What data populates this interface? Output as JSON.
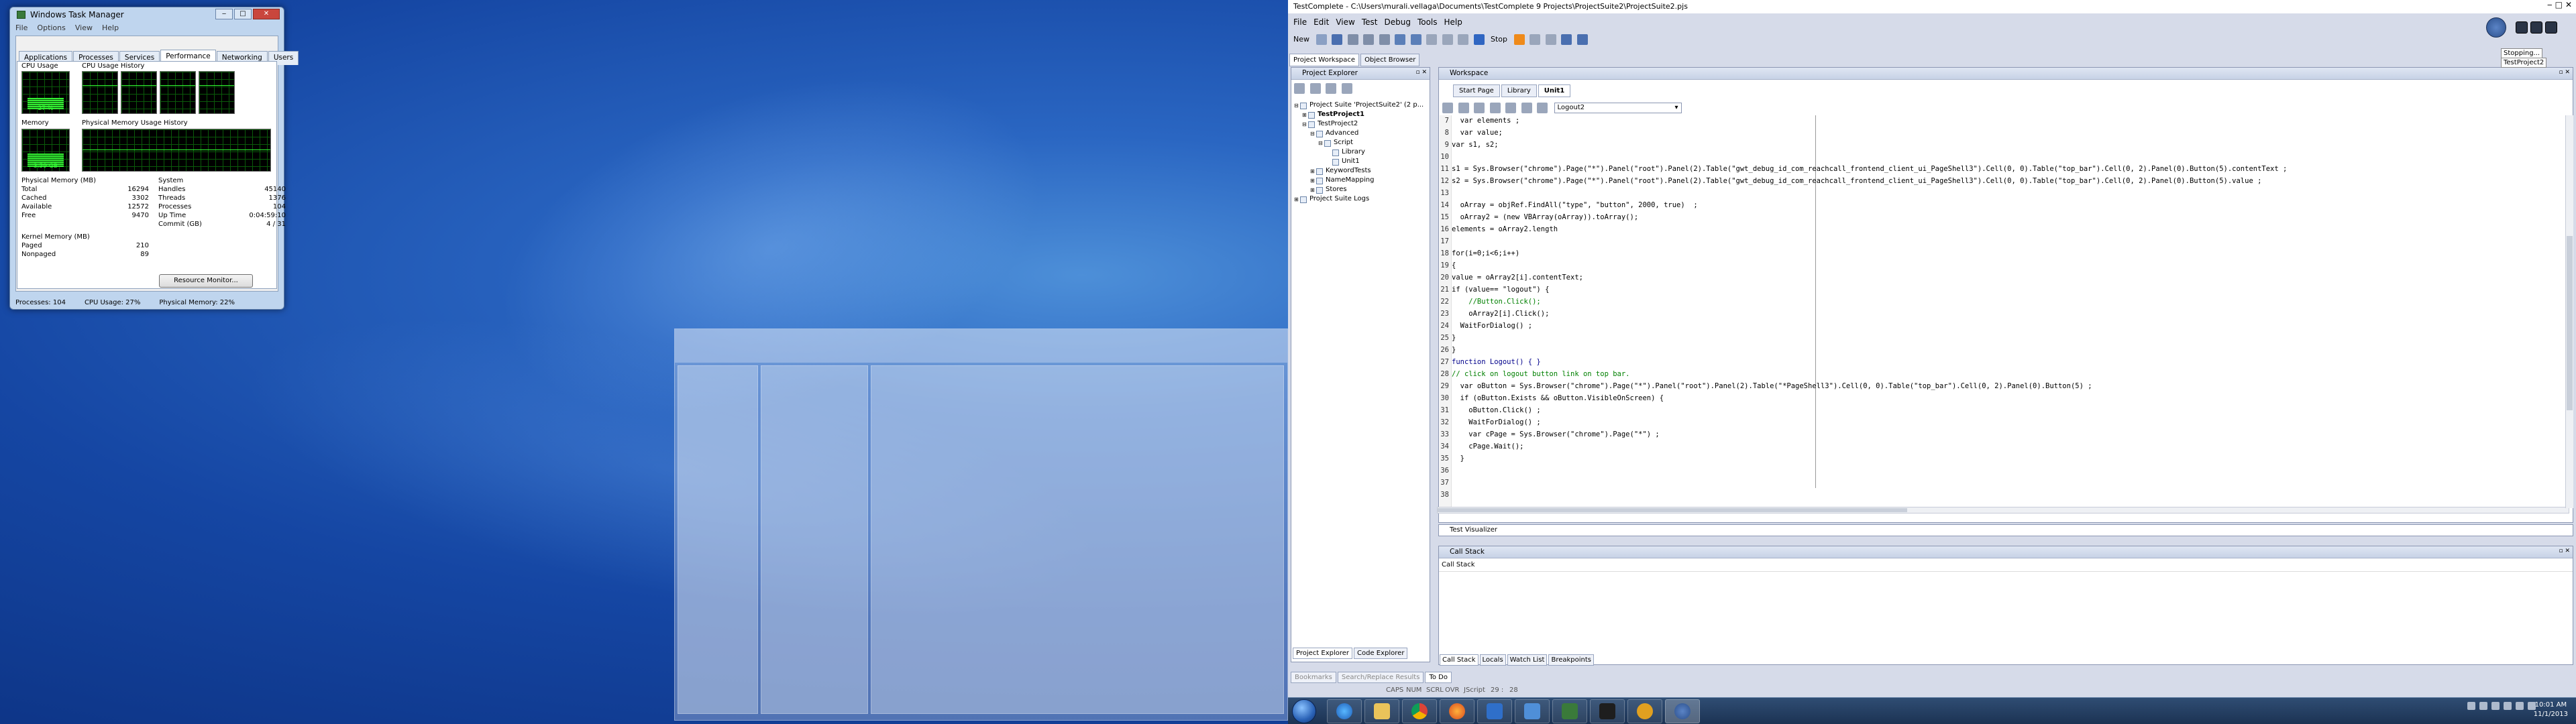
{
  "taskmanager": {
    "title": "Windows Task Manager",
    "menu": [
      "File",
      "Options",
      "View",
      "Help"
    ],
    "tabs": [
      "Applications",
      "Processes",
      "Services",
      "Performance",
      "Networking",
      "Users"
    ],
    "cpu_usage_label": "CPU Usage",
    "cpu_history_label": "CPU Usage History",
    "cpu_usage_value": "27 %",
    "cpu_fraction": 0.27,
    "memory_label": "Memory",
    "memory_value": "3.59 GB",
    "memory_fraction": 0.22,
    "phys_history_label": "Physical Memory Usage History",
    "physical_memory": {
      "title": "Physical Memory (MB)",
      "rows": [
        [
          "Total",
          "16294"
        ],
        [
          "Cached",
          "3302"
        ],
        [
          "Available",
          "12572"
        ],
        [
          "Free",
          "9470"
        ]
      ]
    },
    "system": {
      "title": "System",
      "rows": [
        [
          "Handles",
          "45140"
        ],
        [
          "Threads",
          "1376"
        ],
        [
          "Processes",
          "104"
        ],
        [
          "Up Time",
          "0:04:59:10"
        ],
        [
          "Commit (GB)",
          "4 / 31"
        ]
      ]
    },
    "kernel_memory": {
      "title": "Kernel Memory (MB)",
      "rows": [
        [
          "Paged",
          "210"
        ],
        [
          "Nonpaged",
          "89"
        ]
      ]
    },
    "resource_monitor_button": "Resource Monitor...",
    "status": {
      "processes": "Processes: 104",
      "cpu": "CPU Usage: 27%",
      "memory": "Physical Memory: 22%"
    }
  },
  "testcomplete": {
    "title": "TestComplete - C:\\Users\\murali.vellaga\\Documents\\TestComplete 9 Projects\\ProjectSuite2\\ProjectSuite2.pjs",
    "menu": [
      "File",
      "Edit",
      "View",
      "Test",
      "Debug",
      "Tools",
      "Help"
    ],
    "toolbar": {
      "new_label": "New",
      "stop_label": "Stop"
    },
    "workspace_tabs": [
      "Project Workspace",
      "Object Browser"
    ],
    "project_explorer_title": "Project Explorer",
    "workspace_title": "Workspace",
    "tree": [
      {
        "label": "Project Suite 'ProjectSuite2' (2 p...",
        "depth": 0,
        "exp": "-",
        "bold": false
      },
      {
        "label": "TestProject1",
        "depth": 1,
        "exp": "+",
        "bold": true
      },
      {
        "label": "TestProject2",
        "depth": 1,
        "exp": "-",
        "bold": false
      },
      {
        "label": "Advanced",
        "depth": 2,
        "exp": "-",
        "bold": false
      },
      {
        "label": "Script",
        "depth": 3,
        "exp": "-",
        "bold": false
      },
      {
        "label": "Library",
        "depth": 4,
        "exp": "",
        "bold": false
      },
      {
        "label": "Unit1",
        "depth": 4,
        "exp": "",
        "bold": false
      },
      {
        "label": "KeywordTests",
        "depth": 2,
        "exp": "+",
        "bold": false
      },
      {
        "label": "NameMapping",
        "depth": 2,
        "exp": "+",
        "bold": false
      },
      {
        "label": "Stores",
        "depth": 2,
        "exp": "+",
        "bold": false
      },
      {
        "label": "Project Suite Logs",
        "depth": 0,
        "exp": "+",
        "bold": false
      }
    ],
    "explorer_tabs": [
      "Project Explorer",
      "Code Explorer"
    ],
    "doc_tabs": [
      "Start Page",
      "Library",
      "Unit1"
    ],
    "routine_dropdown": "Logout2",
    "code_lines": [
      [
        "7",
        "  var elements ;"
      ],
      [
        "8",
        "  var value;"
      ],
      [
        "9",
        "var s1, s2;"
      ],
      [
        "10",
        ""
      ],
      [
        "11",
        "s1 = Sys.Browser(\"chrome\").Page(\"*\").Panel(\"root\").Panel(2).Table(\"gwt_debug_id_com_reachcall_frontend_client_ui_PageShell3\").Cell(0, 0).Table(\"top_bar\").Cell(0, 2).Panel(0).Button(5).contentText ;"
      ],
      [
        "12",
        "s2 = Sys.Browser(\"chrome\").Page(\"*\").Panel(\"root\").Panel(2).Table(\"gwt_debug_id_com_reachcall_frontend_client_ui_PageShell3\").Cell(0, 0).Table(\"top_bar\").Cell(0, 2).Panel(0).Button(5).value ;"
      ],
      [
        "13",
        ""
      ],
      [
        "14",
        "  oArray = objRef.FindAll(\"type\", \"button\", 2000, true)  ;"
      ],
      [
        "15",
        "  oArray2 = (new VBArray(oArray)).toArray();"
      ],
      [
        "16",
        "elements = oArray2.length"
      ],
      [
        "17",
        ""
      ],
      [
        "18",
        "for(i=0;i<6;i++)"
      ],
      [
        "19",
        "{"
      ],
      [
        "20",
        "value = oArray2[i].contentText;"
      ],
      [
        "21",
        "if (value== \"logout\") {"
      ],
      [
        "22",
        "    //Button.Click();"
      ],
      [
        "23",
        "    oArray2[i].Click();"
      ],
      [
        "24",
        "  WaitForDialog() ;"
      ],
      [
        "25",
        "}"
      ],
      [
        "26",
        "}"
      ],
      [
        "27",
        "function Logout() { }"
      ],
      [
        "28",
        "// click on logout button link on top bar."
      ],
      [
        "29",
        "  var oButton = Sys.Browser(\"chrome\").Page(\"*\").Panel(\"root\").Panel(2).Table(\"*PageShell3\").Cell(0, 0).Table(\"top_bar\").Cell(0, 2).Panel(0).Button(5) ;"
      ],
      [
        "30",
        "  if (oButton.Exists && oButton.VisibleOnScreen) {"
      ],
      [
        "31",
        "    oButton.Click() ;"
      ],
      [
        "32",
        "    WaitForDialog() ;"
      ],
      [
        "33",
        "    var cPage = Sys.Browser(\"chrome\").Page(\"*\") ;"
      ],
      [
        "34",
        "    cPage.Wait();"
      ],
      [
        "35",
        "  }"
      ],
      [
        "36",
        ""
      ],
      [
        "37",
        ""
      ],
      [
        "38",
        ""
      ]
    ],
    "test_visualizer_title": "Test Visualizer",
    "call_stack_title": "Call Stack",
    "call_stack_header": "Call Stack",
    "callstack_tabs": [
      "Call Stack",
      "Locals",
      "Watch List",
      "Breakpoints"
    ],
    "bottom_tabs": [
      "Bookmarks",
      "Search/Replace Results",
      "To Do"
    ],
    "status": {
      "caps": "CAPS",
      "num": "NUM",
      "scrl": "SCRL",
      "ovr": "OVR",
      "mode": "JScript",
      "position": "29 :",
      "col": "28"
    },
    "stopper": {
      "stopping": "Stopping...",
      "project": "TestProject2"
    }
  },
  "taskbar": {
    "time": "10:01 AM",
    "date": "11/1/2013"
  }
}
